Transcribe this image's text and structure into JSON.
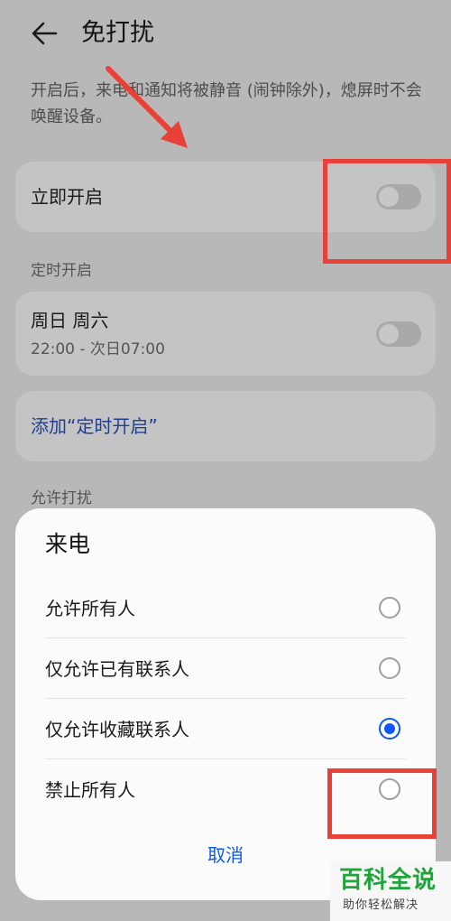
{
  "header": {
    "title": "免打扰",
    "back_icon": "back-arrow-icon"
  },
  "description": "开启后，来电和通知将被静音 (闹钟除外)，熄屏时不会唤醒设备。",
  "immediate": {
    "label": "立即开启",
    "enabled": false
  },
  "schedule": {
    "section_label": "定时开启",
    "item": {
      "days": "周日 周六",
      "time": "22:00 - 次日07:00",
      "enabled": false
    },
    "add_label": "添加“定时开启”"
  },
  "allow": {
    "section_label": "允许打扰"
  },
  "sheet": {
    "title": "来电",
    "options": [
      {
        "label": "允许所有人",
        "selected": false
      },
      {
        "label": "仅允许已有联系人",
        "selected": false
      },
      {
        "label": "仅允许收藏联系人",
        "selected": true
      },
      {
        "label": "禁止所有人",
        "selected": false
      }
    ],
    "cancel_label": "取消"
  },
  "watermark": {
    "main": "百科全说",
    "sub": "助你轻松解决"
  },
  "colors": {
    "accent": "#0a59f7",
    "link": "#1f3f8c",
    "annotation": "#e8413a",
    "watermark": "#1fa33a"
  }
}
